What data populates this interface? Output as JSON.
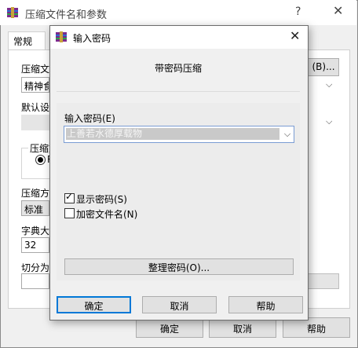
{
  "background_dialog": {
    "title": "压缩文件名和参数",
    "help_glyph": "?",
    "close_glyph": "✕",
    "tab_general": "常规",
    "filename_label": "压缩文件名(A)",
    "browse_button": "(B)...",
    "filename_value": "精神食粮.rar",
    "profile_label": "默认设置",
    "format_group_label": "压缩文件格式",
    "format_radio_text": "RAR",
    "method_label": "压缩方式",
    "method_value": "标准",
    "dict_label": "字典大小",
    "dict_value": "32",
    "split_label": "切分为",
    "ok_button": "确定",
    "cancel_button": "取消",
    "help_button": "帮助"
  },
  "password_dialog": {
    "title": "输入密码",
    "close_glyph": "✕",
    "header": "带密码压缩",
    "input_label": "输入密码(E)",
    "input_value": "上善若水德厚载物",
    "chevron": "⌵",
    "show_password_label": "显示密码(S)",
    "show_password_checked": true,
    "check_glyph": "✓",
    "encrypt_filenames_label": "加密文件名(N)",
    "encrypt_filenames_checked": false,
    "organize_button": "整理密码(O)...",
    "ok_button": "确定",
    "cancel_button": "取消",
    "help_button": "帮助"
  },
  "colors": {
    "focus_border": "#0078d7",
    "dialog_bg": "#f0f0f0",
    "button_bg": "#e1e1e1"
  }
}
